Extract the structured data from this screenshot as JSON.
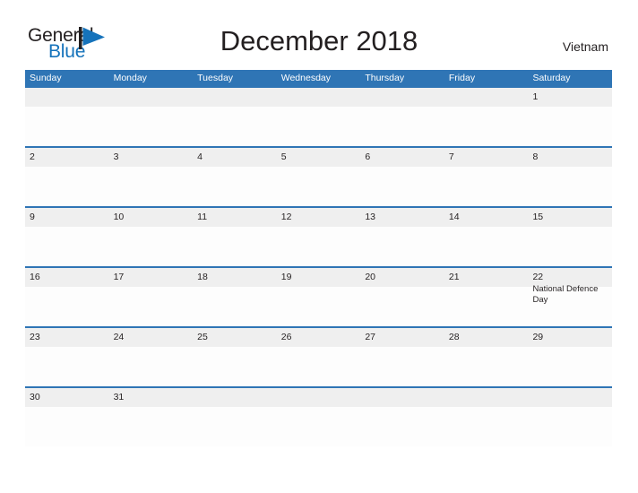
{
  "brand": {
    "name_part1": "General",
    "name_part2": "Blue",
    "mark_color": "#1673bb",
    "text_color": "#231f20"
  },
  "header": {
    "title": "December 2018",
    "region": "Vietnam"
  },
  "theme": {
    "header_blue": "#2f75b5",
    "row_band_gray": "#efefef",
    "page_background": "#ffffff",
    "text_color": "#231f20"
  },
  "calendar": {
    "weekday_headers": [
      "Sunday",
      "Monday",
      "Tuesday",
      "Wednesday",
      "Thursday",
      "Friday",
      "Saturday"
    ],
    "weeks": [
      [
        {
          "day": "",
          "event": ""
        },
        {
          "day": "",
          "event": ""
        },
        {
          "day": "",
          "event": ""
        },
        {
          "day": "",
          "event": ""
        },
        {
          "day": "",
          "event": ""
        },
        {
          "day": "",
          "event": ""
        },
        {
          "day": "1",
          "event": ""
        }
      ],
      [
        {
          "day": "2",
          "event": ""
        },
        {
          "day": "3",
          "event": ""
        },
        {
          "day": "4",
          "event": ""
        },
        {
          "day": "5",
          "event": ""
        },
        {
          "day": "6",
          "event": ""
        },
        {
          "day": "7",
          "event": ""
        },
        {
          "day": "8",
          "event": ""
        }
      ],
      [
        {
          "day": "9",
          "event": ""
        },
        {
          "day": "10",
          "event": ""
        },
        {
          "day": "11",
          "event": ""
        },
        {
          "day": "12",
          "event": ""
        },
        {
          "day": "13",
          "event": ""
        },
        {
          "day": "14",
          "event": ""
        },
        {
          "day": "15",
          "event": ""
        }
      ],
      [
        {
          "day": "16",
          "event": ""
        },
        {
          "day": "17",
          "event": ""
        },
        {
          "day": "18",
          "event": ""
        },
        {
          "day": "19",
          "event": ""
        },
        {
          "day": "20",
          "event": ""
        },
        {
          "day": "21",
          "event": ""
        },
        {
          "day": "22",
          "event": "National Defence Day"
        }
      ],
      [
        {
          "day": "23",
          "event": ""
        },
        {
          "day": "24",
          "event": ""
        },
        {
          "day": "25",
          "event": ""
        },
        {
          "day": "26",
          "event": ""
        },
        {
          "day": "27",
          "event": ""
        },
        {
          "day": "28",
          "event": ""
        },
        {
          "day": "29",
          "event": ""
        }
      ],
      [
        {
          "day": "30",
          "event": ""
        },
        {
          "day": "31",
          "event": ""
        },
        {
          "day": "",
          "event": ""
        },
        {
          "day": "",
          "event": ""
        },
        {
          "day": "",
          "event": ""
        },
        {
          "day": "",
          "event": ""
        },
        {
          "day": "",
          "event": ""
        }
      ]
    ]
  }
}
